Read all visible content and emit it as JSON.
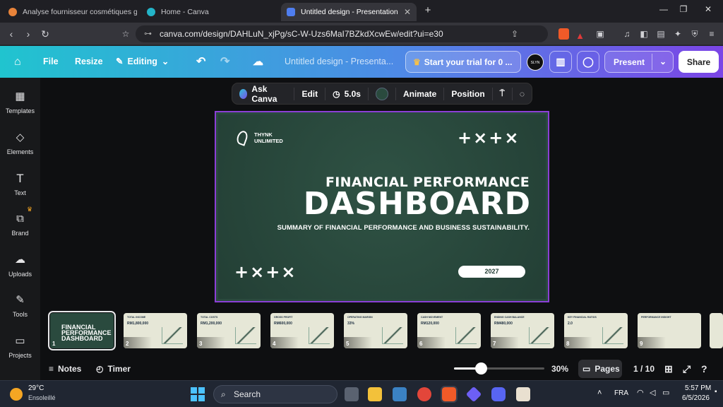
{
  "browser": {
    "tabs": [
      {
        "title": "Analyse fournisseur cosmétiques gro",
        "color": "#e8833a"
      },
      {
        "title": "Home - Canva",
        "color": "#23b4c8"
      },
      {
        "title": "Untitled design - Presentation",
        "color": "#4f7ef0"
      }
    ],
    "new_tab": "+",
    "url": "canva.com/design/DAHLuN_xjPg/sC-W-Uzs6MaI7BZkdXcwEw/edit?ui=e30"
  },
  "canva": {
    "file": "File",
    "resize": "Resize",
    "editing": "Editing",
    "doc_title": "Untitled design - Presenta...",
    "trial": "Start your trial for 0 ...",
    "avatar": "SLYN",
    "present": "Present",
    "share": "Share"
  },
  "rail": [
    {
      "label": "Templates",
      "icon": "templates-icon"
    },
    {
      "label": "Elements",
      "icon": "elements-icon"
    },
    {
      "label": "Text",
      "icon": "text-icon"
    },
    {
      "label": "Brand",
      "icon": "brand-icon"
    },
    {
      "label": "Uploads",
      "icon": "uploads-icon"
    },
    {
      "label": "Tools",
      "icon": "tools-icon"
    },
    {
      "label": "Projects",
      "icon": "projects-icon"
    }
  ],
  "context_bar": {
    "ask": "Ask Canva",
    "edit": "Edit",
    "duration": "5.0s",
    "animate": "Animate",
    "position": "Position"
  },
  "slide": {
    "brand_line1": "THYNK",
    "brand_line2": "UNLIMITED",
    "marks": "+×+×",
    "title_small": "FINANCIAL PERFORMANCE",
    "title_big": "DASHBOARD",
    "subtitle": "SUMMARY OF FINANCIAL PERFORMANCE AND BUSINESS SUSTAINABILITY.",
    "year": "2027",
    "bg_color": "#2a4a3e"
  },
  "thumbnails": [
    {
      "num": "1",
      "title": "FINANCIAL PERFORMANCE DASHBOARD",
      "value": ""
    },
    {
      "num": "2",
      "title": "TOTAL INCOME",
      "value": "RM1,800,000"
    },
    {
      "num": "3",
      "title": "TOTAL COSTS",
      "value": "RM1,200,000"
    },
    {
      "num": "4",
      "title": "GROSS PROFIT",
      "value": "RM600,000"
    },
    {
      "num": "5",
      "title": "OPERATING MARGIN",
      "value": "33%"
    },
    {
      "num": "6",
      "title": "CASH MOVEMENT",
      "value": "RM120,000"
    },
    {
      "num": "7",
      "title": "ENDING CASH BALANCE",
      "value": "RM480,000"
    },
    {
      "num": "8",
      "title": "KEY FINANCIAL RATIOS",
      "value": "2.0"
    },
    {
      "num": "9",
      "title": "PERFORMANCE INSIGHT",
      "value": ""
    }
  ],
  "bottom": {
    "notes": "Notes",
    "timer": "Timer",
    "zoom": "30%",
    "zoom_fraction": 0.3,
    "pages": "Pages",
    "page_count": "1 / 10"
  },
  "taskbar": {
    "temp": "29°C",
    "weather": "Ensoleillé",
    "search": "Search",
    "lang": "FRA",
    "time": "5:57 PM",
    "date": "6/5/2026"
  }
}
